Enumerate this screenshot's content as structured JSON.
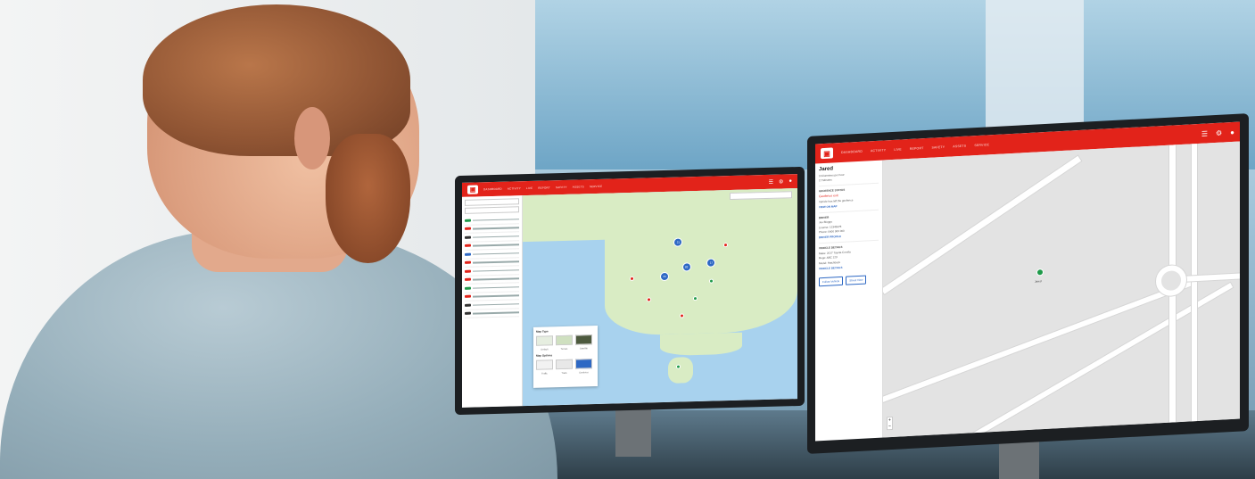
{
  "colors": {
    "brand": "#e2231a",
    "link": "#2d68c4",
    "vehicle": "#1f9a4a"
  },
  "left_monitor": {
    "nav": [
      "DASHBOARD",
      "ACTIVITY",
      "LIVE",
      "REPORT",
      "SAFETY",
      "ASSETS",
      "SERVICE"
    ],
    "icons": [
      "list-icon",
      "gear-icon",
      "help-icon"
    ],
    "clusters": [
      "21",
      "17",
      "23",
      "83"
    ],
    "map_type_panel": {
      "title": "Map Type",
      "types": [
        "Default",
        "Terrain",
        "Satellite"
      ],
      "details_title": "Map Options",
      "details": [
        "Traffic",
        "Trails",
        "Geofence"
      ]
    }
  },
  "right_monitor": {
    "nav": [
      "DASHBOARD",
      "ACTIVITY",
      "LIVE",
      "REPORT",
      "SAFETY",
      "ASSETS",
      "SERVICE"
    ],
    "icons": [
      "list-icon",
      "gear-icon",
      "help-icon"
    ],
    "detail": {
      "name": "Jared",
      "line1": "0 Kilometres per hour",
      "line2": "17 Minutes",
      "status_heading": "GEOFENCE STATUS",
      "status": "Geofence exit",
      "note": "Vehicle has left the geofence",
      "note_link": "VIEW ON MAP",
      "driver_heading": "DRIVER",
      "driver_name": "Joe Bloggs",
      "license": "License: 12345678",
      "phone": "Phone: 0400 000 000",
      "driver_link": "DRIVER PROFILE",
      "vehicle_heading": "VEHICLE DETAILS",
      "vehicle_make": "Make: 2017 Toyota Corolla",
      "vehicle_rego": "Rego: ABC 123",
      "vehicle_model": "Model: Hatchback",
      "vehicle_link": "VEHICLE DETAILS",
      "buttons": [
        "Follow Vehicle",
        "Street View"
      ]
    },
    "vehicle_label": "Jared"
  }
}
